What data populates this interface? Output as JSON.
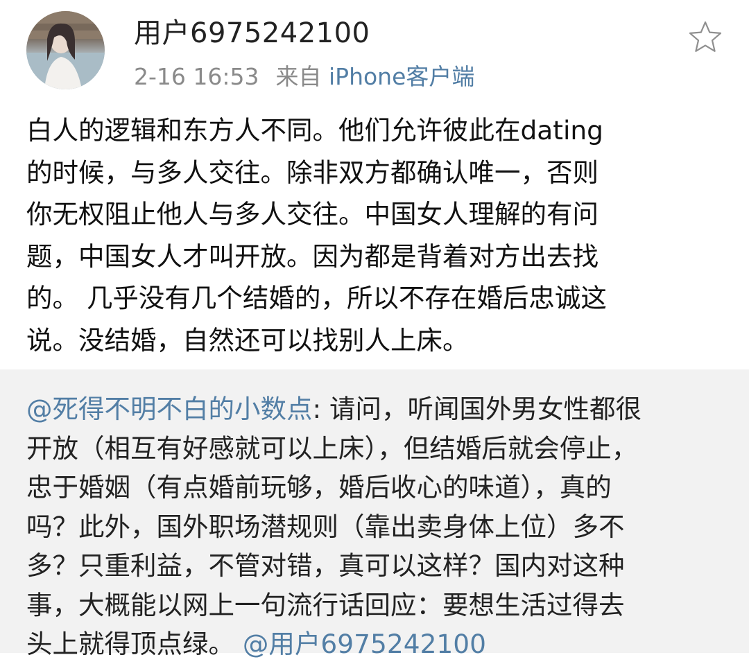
{
  "post": {
    "author": "用户6975242100",
    "time": "2-16 16:53",
    "source_prefix": "来自",
    "source_client": "iPhone客户端",
    "lines": [
      "白人的逻辑和东方人不同。他们允许彼此在dating",
      "的时候，与多人交往。除非双方都确认唯一，否则",
      "你无权阻止他人与多人交往。中国女人理解的有问",
      "题，中国女人才叫开放。因为都是背着对方出去找",
      "的。 几乎没有几个结婚的，所以不存在婚后忠诚这",
      "说。没结婚，自然还可以找别人上床。"
    ]
  },
  "repost": {
    "author_mention": "@死得不明不白的小数点",
    "line1_rest": ": 请问，听闻国外男女性都很",
    "lines": [
      "开放（相互有好感就可以上床），但结婚后就会停止，",
      "忠于婚姻（有点婚前玩够，婚后收心的味道），真的",
      "吗？此外，国外职场潜规则（靠出卖身体上位）多不",
      "多？只重利益，不管对错，真可以这样？国内对这种",
      "事，大概能以网上一句流行话回应：要想生活过得去"
    ],
    "last_line_text": "头上就得顶点绿。",
    "trailing_mention": "@用户6975242100"
  },
  "colors": {
    "link": "#527ea5",
    "meta": "#8a8a8a",
    "repost_bg": "#f2f2f2"
  },
  "icons": {
    "favorite": "star-outline-icon"
  }
}
